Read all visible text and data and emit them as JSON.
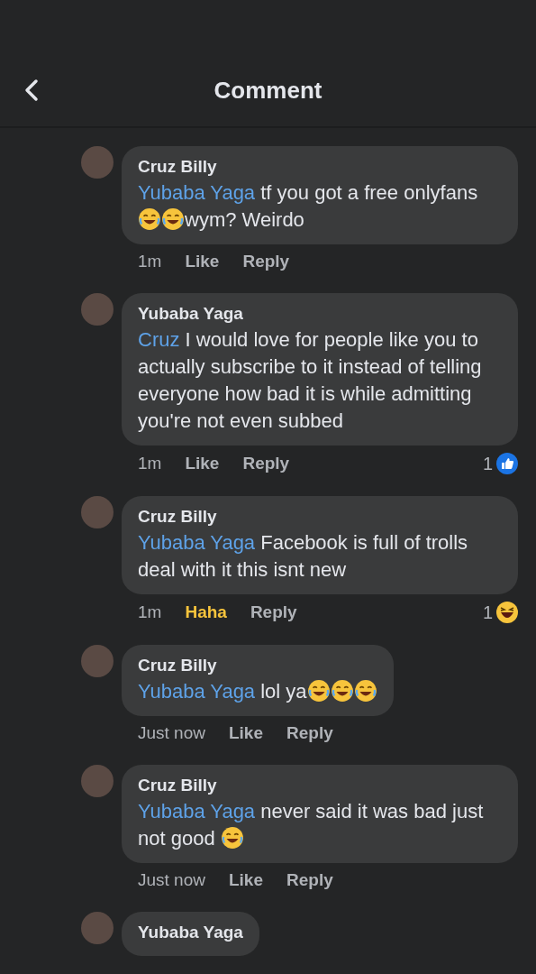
{
  "header": {
    "title": "Comment"
  },
  "comments": [
    {
      "author": "Cruz Billy",
      "body": [
        {
          "kind": "mention",
          "text": "Yubaba Yaga"
        },
        {
          "kind": "text",
          "text": " tf you got a free onlyfans "
        },
        {
          "kind": "emoji"
        },
        {
          "kind": "emoji"
        },
        {
          "kind": "text",
          "text": "wym? Weirdo"
        }
      ],
      "time": "1m",
      "like": {
        "label": "Like",
        "reacted": false
      },
      "reply": "Reply"
    },
    {
      "author": "Yubaba Yaga",
      "body": [
        {
          "kind": "mention",
          "text": "Cruz"
        },
        {
          "kind": "text",
          "text": " I would love for people like you to actually subscribe to it instead of telling everyone how bad it is while admitting you're not even subbed"
        }
      ],
      "time": "1m",
      "like": {
        "label": "Like",
        "reacted": false
      },
      "reply": "Reply",
      "reactions": {
        "count": "1",
        "kind": "like"
      }
    },
    {
      "author": "Cruz Billy",
      "body": [
        {
          "kind": "mention",
          "text": "Yubaba Yaga"
        },
        {
          "kind": "text",
          "text": " Facebook is full of trolls deal with it this isnt new"
        }
      ],
      "time": "1m",
      "like": {
        "label": "Haha",
        "reacted": true
      },
      "reply": "Reply",
      "reactions": {
        "count": "1",
        "kind": "haha"
      }
    },
    {
      "author": "Cruz Billy",
      "body": [
        {
          "kind": "mention",
          "text": "Yubaba Yaga"
        },
        {
          "kind": "text",
          "text": " lol ya"
        },
        {
          "kind": "emoji"
        },
        {
          "kind": "emoji"
        },
        {
          "kind": "emoji"
        }
      ],
      "time": "Just now",
      "like": {
        "label": "Like",
        "reacted": false
      },
      "reply": "Reply"
    },
    {
      "author": "Cruz Billy",
      "body": [
        {
          "kind": "mention",
          "text": "Yubaba Yaga"
        },
        {
          "kind": "text",
          "text": " never said it was bad just not good "
        },
        {
          "kind": "emoji"
        }
      ],
      "time": "Just now",
      "like": {
        "label": "Like",
        "reacted": false
      },
      "reply": "Reply"
    },
    {
      "author": "Yubaba Yaga"
    }
  ]
}
